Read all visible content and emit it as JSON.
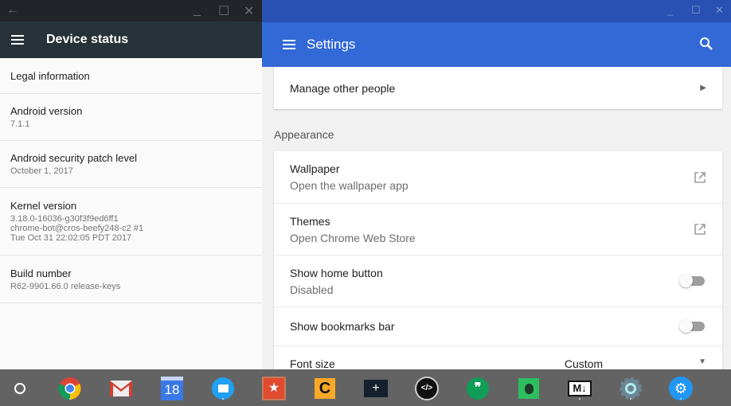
{
  "device_status": {
    "title": "Device status",
    "items": [
      {
        "title": "Legal information",
        "subtitle": ""
      },
      {
        "title": "Android version",
        "subtitle": "7.1.1"
      },
      {
        "title": "Android security patch level",
        "subtitle": "October 1, 2017"
      },
      {
        "title": "Kernel version",
        "subtitle": "3.18.0-16036-g30f3f9ed6ff1",
        "subtitle2": "chrome-bot@cros-beefy248-c2 #1",
        "subtitle3": "Tue Oct 31 22:02:05 PDT 2017"
      },
      {
        "title": "Build number",
        "subtitle": "R62-9901.66.0 release-keys"
      }
    ]
  },
  "settings": {
    "title": "Settings",
    "manage_people": "Manage other people",
    "appearance_header": "Appearance",
    "rows": [
      {
        "title": "Wallpaper",
        "subtitle": "Open the wallpaper app",
        "control": "external-link"
      },
      {
        "title": "Themes",
        "subtitle": "Open Chrome Web Store",
        "control": "external-link"
      },
      {
        "title": "Show home button",
        "subtitle": "Disabled",
        "control": "toggle",
        "value": false
      },
      {
        "title": "Show bookmarks bar",
        "subtitle": "",
        "control": "toggle",
        "value": false
      }
    ],
    "font_size_label": "Font size",
    "font_size_value": "Custom"
  },
  "shelf": {
    "apps": [
      {
        "name": "launcher",
        "label": ""
      },
      {
        "name": "chrome",
        "label": ""
      },
      {
        "name": "gmail",
        "label": ""
      },
      {
        "name": "calendar",
        "label": "18"
      },
      {
        "name": "files",
        "label": ""
      },
      {
        "name": "wunderlist",
        "label": ""
      },
      {
        "name": "cloud-app",
        "label": "C"
      },
      {
        "name": "terminal",
        "label": "+"
      },
      {
        "name": "caret",
        "label": "</>"
      },
      {
        "name": "hangouts",
        "label": "❞"
      },
      {
        "name": "evernote",
        "label": ""
      },
      {
        "name": "markdown",
        "label": "M↓"
      },
      {
        "name": "android-settings",
        "label": ""
      },
      {
        "name": "chrome-settings",
        "label": ""
      }
    ]
  }
}
